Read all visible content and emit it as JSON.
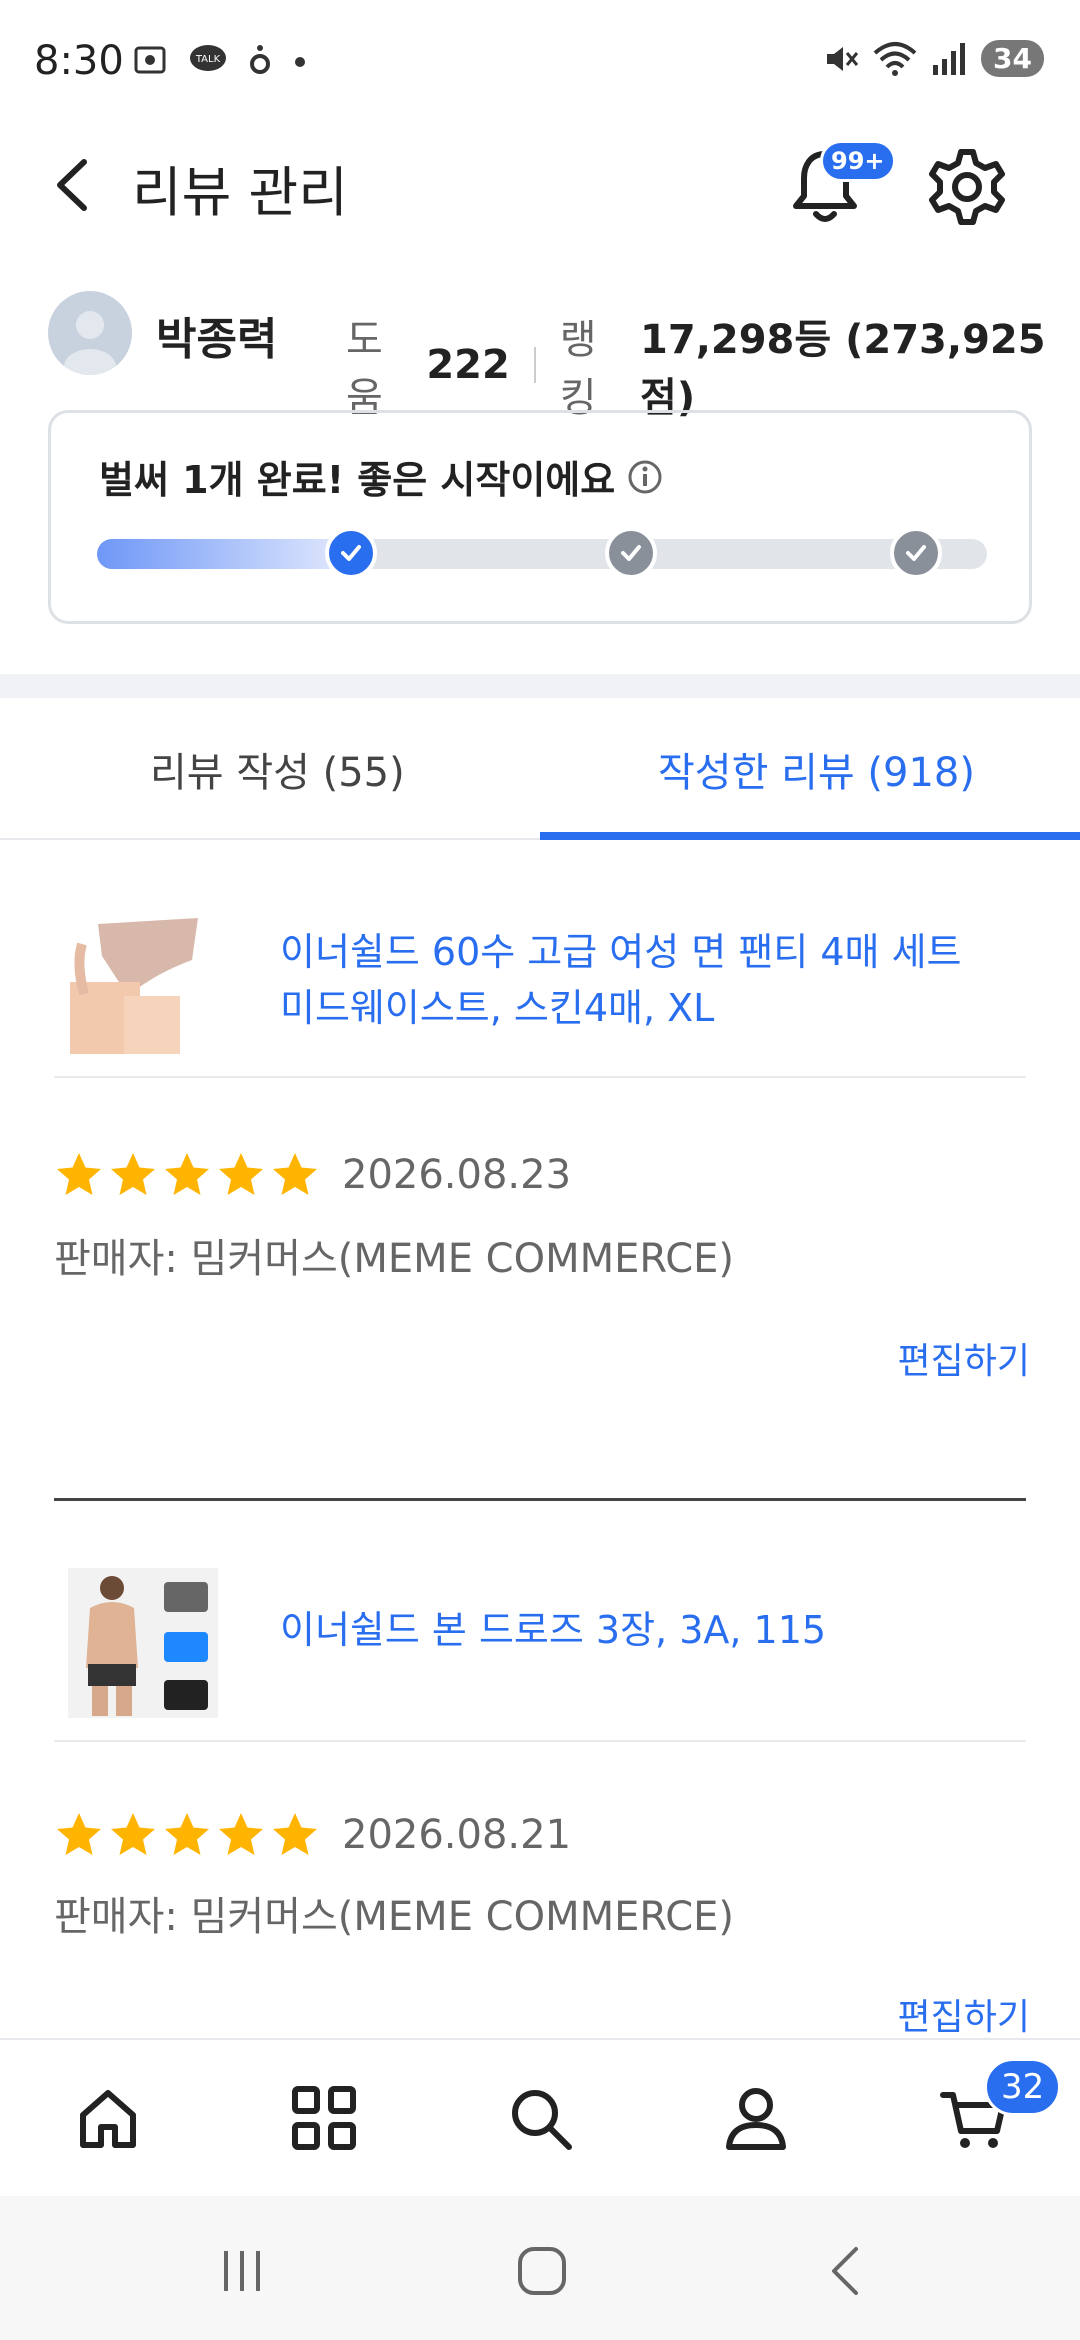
{
  "status_bar": {
    "time": "8:30",
    "battery": "34"
  },
  "header": {
    "title": "리뷰 관리",
    "notification_badge": "99+"
  },
  "profile": {
    "name": "박종력",
    "help_label": "도움",
    "help_count": "222",
    "ranking_label": "랭킹",
    "ranking_value": "17,298등 (273,925점)"
  },
  "progress": {
    "message": "벌써 1개 완료! 좋은 시작이에요",
    "completed_steps": 1,
    "total_steps": 3,
    "colors": {
      "fill_start": "#6e97f7",
      "done": "#2a6ef0",
      "pending": "#8a9099"
    }
  },
  "tabs": [
    {
      "label": "리뷰 작성 (55)",
      "active": false
    },
    {
      "label": "작성한 리뷰 (918)",
      "active": true
    }
  ],
  "reviews": [
    {
      "product": "이너쉴드 60수 고급 여성 면 팬티 4매 세트 미드웨이스트, 스킨4매, XL",
      "rating": 5,
      "date": "2026.08.23",
      "seller": "판매자: 밈커머스(MEME COMMERCE)",
      "edit_label": "편집하기"
    },
    {
      "product": "이너쉴드 본 드로즈 3장, 3A, 115",
      "rating": 5,
      "date": "2026.08.21",
      "seller": "판매자: 밈커머스(MEME COMMERCE)",
      "edit_label": "편집하기"
    }
  ],
  "bottom_nav": {
    "items": [
      "home-icon",
      "category-grid-icon",
      "search-icon",
      "user-icon",
      "cart-icon"
    ],
    "cart_badge": "32"
  },
  "accent_color": "#2a6ef0",
  "star_color": "#ffb400"
}
